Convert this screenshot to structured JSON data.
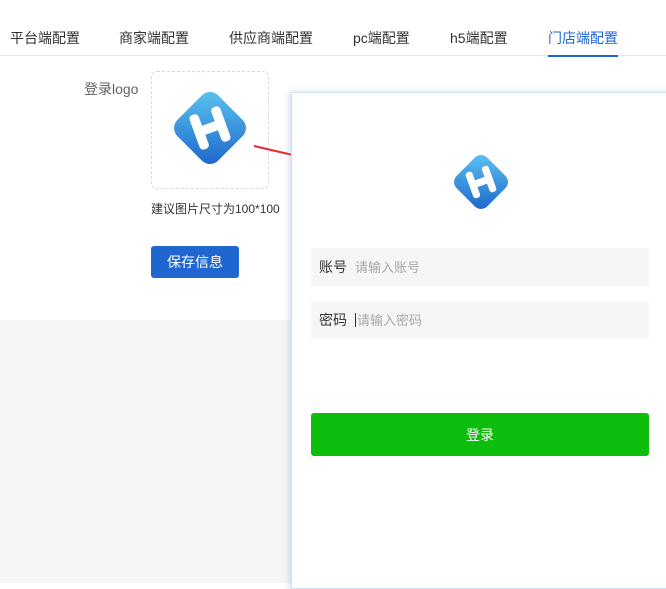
{
  "tabs": [
    {
      "label": "平台端配置",
      "active": false
    },
    {
      "label": "商家端配置",
      "active": false
    },
    {
      "label": "供应商端配置",
      "active": false
    },
    {
      "label": "pc端配置",
      "active": false
    },
    {
      "label": "h5端配置",
      "active": false
    },
    {
      "label": "门店端配置",
      "active": true
    }
  ],
  "form": {
    "logo_label": "登录logo",
    "size_hint": "建议图片尺寸为100*100",
    "save_label": "保存信息"
  },
  "preview": {
    "account_label": "账号",
    "account_placeholder": "请输入账号",
    "password_label": "密码",
    "password_placeholder": "请输入密码",
    "login_label": "登录"
  },
  "colors": {
    "accent": "#1f66d1",
    "login_green": "#0cbd0c",
    "arrow_red": "#e8262b"
  },
  "icons": {
    "logo": "h-diamond-logo-icon",
    "arrow": "red-arrow-icon"
  }
}
